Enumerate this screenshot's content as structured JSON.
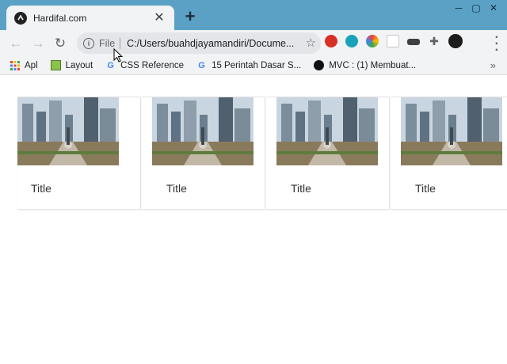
{
  "tab": {
    "title": "Hardifal.com",
    "close": "✕",
    "new_tab": "+"
  },
  "window": {
    "minimize": "─",
    "maximize": "▢",
    "close": "✕"
  },
  "toolbar": {
    "back": "←",
    "forward": "→",
    "reload": "↻",
    "scheme_label": "File",
    "url": "C:/Users/buahdjayamandiri/Docume...",
    "star": "☆"
  },
  "bookmarks": [
    {
      "label": "Apl",
      "icon": "apps-grid-icon"
    },
    {
      "label": "Layout",
      "icon": "layout-favicon-icon"
    },
    {
      "label": "CSS Reference",
      "icon": "google-g-icon"
    },
    {
      "label": "15 Perintah Dasar S...",
      "icon": "google-g-icon"
    },
    {
      "label": "MVC : (1) Membuat...",
      "icon": "dark-circle-favicon-icon"
    }
  ],
  "bookmarks_more": "»",
  "cards": [
    {
      "title": "Title"
    },
    {
      "title": "Title"
    },
    {
      "title": "Title"
    },
    {
      "title": "Title"
    }
  ],
  "colors": {
    "titlebar": "#5aa1c5",
    "toolbar": "#f1f3f4",
    "omnibox": "#e3e5e8"
  }
}
